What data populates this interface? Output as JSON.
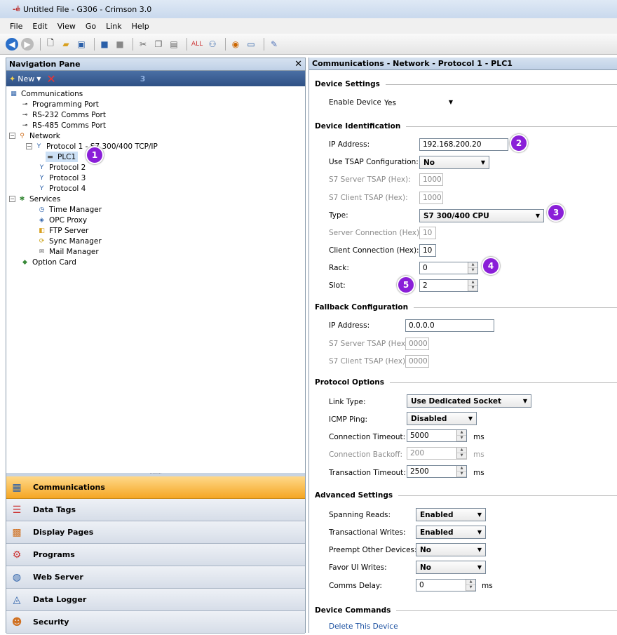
{
  "window": {
    "title": "Untitled File - G306 - Crimson 3.0"
  },
  "menu": [
    "File",
    "Edit",
    "View",
    "Go",
    "Link",
    "Help"
  ],
  "nav": {
    "title": "Navigation Pane",
    "new_label": "New",
    "tree": {
      "communications": "Communications",
      "programming_port": "Programming Port",
      "rs232": "RS-232 Comms Port",
      "rs485": "RS-485 Comms Port",
      "network": "Network",
      "protocol1": "Protocol 1 - S7 300/400 TCP/IP",
      "plc1": "PLC1",
      "protocol2": "Protocol 2",
      "protocol3": "Protocol 3",
      "protocol4": "Protocol 4",
      "services": "Services",
      "time_manager": "Time Manager",
      "opc_proxy": "OPC Proxy",
      "ftp_server": "FTP Server",
      "sync_manager": "Sync Manager",
      "mail_manager": "Mail Manager",
      "option_card": "Option Card"
    },
    "categories": [
      "Communications",
      "Data Tags",
      "Display Pages",
      "Programs",
      "Web Server",
      "Data Logger",
      "Security"
    ]
  },
  "panel": {
    "title": "Communications - Network - Protocol 1 - PLC1",
    "device_settings": {
      "heading": "Device Settings",
      "enable_label": "Enable Device:",
      "enable_value": "Yes"
    },
    "device_identification": {
      "heading": "Device Identification",
      "ip_label": "IP Address:",
      "ip_value": "192.168.200.20",
      "tsap_label": "Use TSAP Configuration:",
      "tsap_value": "No",
      "server_tsap_label": "S7 Server TSAP (Hex):",
      "server_tsap_value": "1000",
      "client_tsap_label": "S7 Client TSAP (Hex):",
      "client_tsap_value": "1000",
      "type_label": "Type:",
      "type_value": "S7 300/400 CPU",
      "server_conn_label": "Server Connection (Hex):",
      "server_conn_value": "10",
      "client_conn_label": "Client Connection (Hex):",
      "client_conn_value": "10",
      "rack_label": "Rack:",
      "rack_value": "0",
      "slot_label": "Slot:",
      "slot_value": "2"
    },
    "fallback": {
      "heading": "Fallback Configuration",
      "ip_label": "IP Address:",
      "ip_value": "0.0.0.0",
      "server_tsap_label": "S7 Server TSAP (Hex):",
      "server_tsap_value": "0000",
      "client_tsap_label": "S7 Client TSAP (Hex):",
      "client_tsap_value": "0000"
    },
    "protocol_options": {
      "heading": "Protocol Options",
      "link_label": "Link Type:",
      "link_value": "Use Dedicated Socket",
      "icmp_label": "ICMP Ping:",
      "icmp_value": "Disabled",
      "conn_timeout_label": "Connection Timeout:",
      "conn_timeout_value": "5000",
      "conn_backoff_label": "Connection Backoff:",
      "conn_backoff_value": "200",
      "trans_timeout_label": "Transaction Timeout:",
      "trans_timeout_value": "2500",
      "unit": "ms"
    },
    "advanced": {
      "heading": "Advanced Settings",
      "spanning_label": "Spanning Reads:",
      "spanning_value": "Enabled",
      "trans_writes_label": "Transactional Writes:",
      "trans_writes_value": "Enabled",
      "preempt_label": "Preempt Other Devices:",
      "preempt_value": "No",
      "favor_label": "Favor UI Writes:",
      "favor_value": "No",
      "delay_label": "Comms Delay:",
      "delay_value": "0"
    },
    "commands": {
      "heading": "Device Commands",
      "delete_label": "Delete This Device"
    }
  },
  "badges": [
    "1",
    "2",
    "3",
    "4",
    "5"
  ],
  "nav_toolbar_number": "3",
  "colors": {
    "badge": "#8a1fd8",
    "active_category": "#f5a623",
    "link": "#1a4fa0"
  }
}
